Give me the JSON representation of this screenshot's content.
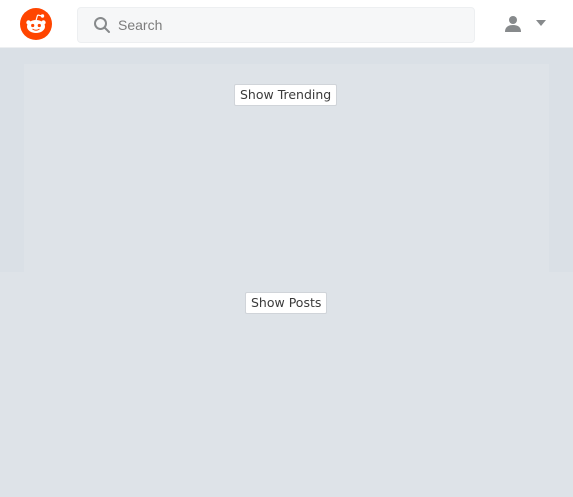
{
  "header": {
    "logo": "reddit-logo",
    "search": {
      "placeholder": "Search",
      "value": ""
    },
    "user_menu": {
      "icon": "user-icon",
      "dropdown_icon": "caret-down-icon"
    }
  },
  "trending": {
    "button_label": "Show Trending"
  },
  "posts": {
    "button_label": "Show Posts"
  },
  "colors": {
    "brand": "#ff4500",
    "page_background": "#dae0e6",
    "panel_background": "#dee3e8"
  }
}
